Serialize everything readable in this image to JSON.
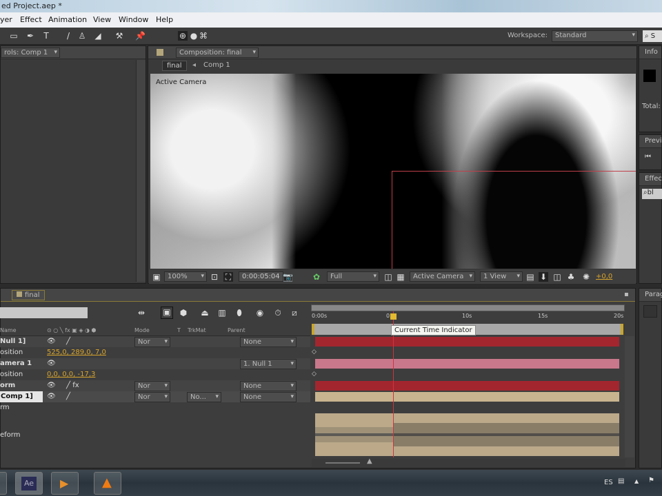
{
  "window": {
    "title": "ed Project.aep *"
  },
  "menu": [
    "yer",
    "Effect",
    "Animation",
    "View",
    "Window",
    "Help"
  ],
  "toolbar": {
    "workspace_label": "Workspace:",
    "workspace_value": "Standard",
    "search_placeholder": "S"
  },
  "left_panel": {
    "tab": "rols: Comp 1"
  },
  "composition": {
    "tab": "Composition: final",
    "breadcrumb": [
      "final",
      "Comp 1"
    ],
    "viewer_label": "Active Camera",
    "zoom": "100%",
    "timecode": "0:00:05:04",
    "resolution": "Full",
    "camera": "Active Camera",
    "views": "1 View",
    "exposure": "+0,0"
  },
  "right_panels": {
    "info": "Info",
    "info_total": "Total:",
    "preview": "Previ",
    "effects": "Effec",
    "effects_search": "bl",
    "paragraph": "Parag"
  },
  "timeline": {
    "tab": "final",
    "columns": {
      "name": "Name",
      "mode": "Mode",
      "t": "T",
      "trkmat": "TrkMat",
      "parent": "Parent"
    },
    "ruler": [
      "0:00s",
      "05s",
      "10s",
      "15s",
      "20s"
    ],
    "tooltip": "Current Time Indicator",
    "rows": [
      {
        "name": "Null 1]",
        "mode": "Nor",
        "parent": "None"
      },
      {
        "name": "osition",
        "value": "525,0, 289,0, 7,0"
      },
      {
        "name": "amera 1",
        "parent": "1. Null 1"
      },
      {
        "name": "osition",
        "value": "0,0, 0,0, -17,3"
      },
      {
        "name": "orm",
        "mode": "Nor",
        "parent": "None"
      },
      {
        "name": "Comp 1]",
        "mode": "Nor",
        "trkmat": "No...",
        "parent": "None"
      },
      {
        "name": "rm"
      },
      {
        "name": "eform"
      }
    ]
  },
  "taskbar": {
    "ae": "Ae",
    "lang": "ES"
  },
  "colors": {
    "null_bar": "#a3262f",
    "camera_bar": "#c9788c",
    "audio_bar": "#c8b48e",
    "cti": "#d2333d",
    "accent": "#d9a52b"
  }
}
